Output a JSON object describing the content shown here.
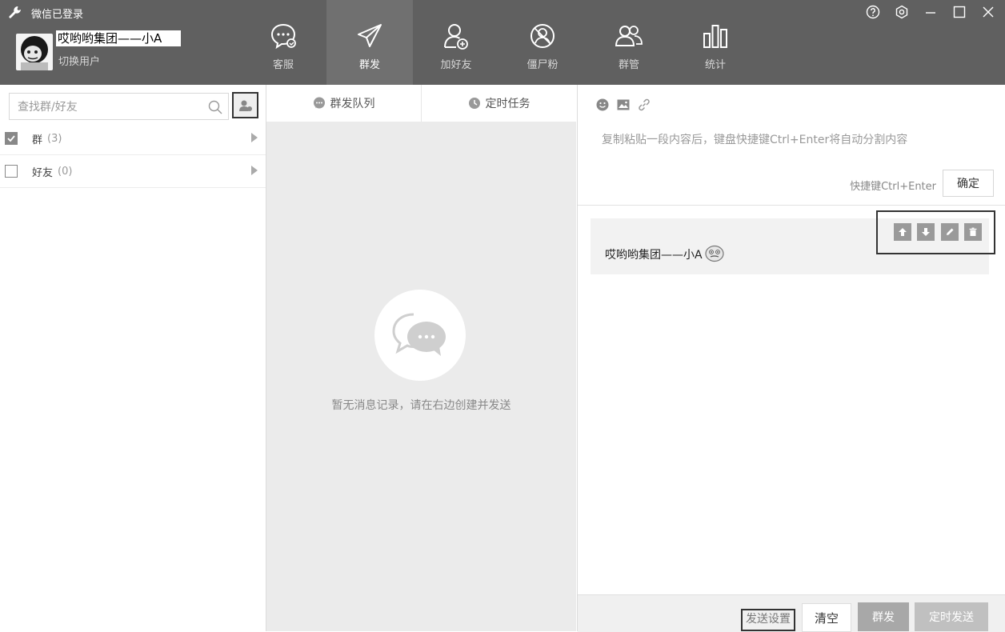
{
  "app": {
    "title": "微信已登录",
    "user_name": "哎哟哟集团——小A",
    "switch_user": "切换用户"
  },
  "nav": [
    {
      "label": "客服",
      "icon": "chat-service-icon"
    },
    {
      "label": "群发",
      "icon": "paper-plane-icon",
      "active": true
    },
    {
      "label": "加好友",
      "icon": "add-friend-icon"
    },
    {
      "label": "僵尸粉",
      "icon": "zombie-fan-icon"
    },
    {
      "label": "群管",
      "icon": "group-manage-icon"
    },
    {
      "label": "统计",
      "icon": "bar-stats-icon"
    }
  ],
  "left": {
    "search_placeholder": "查找群/好友",
    "tree": [
      {
        "name": "群",
        "count": "(3)",
        "checked": true
      },
      {
        "name": "好友",
        "count": "(0)",
        "checked": false
      }
    ]
  },
  "middle": {
    "tabs": [
      {
        "label": "群发队列",
        "icon": "chat-bubble-icon"
      },
      {
        "label": "定时任务",
        "icon": "clock-icon"
      }
    ],
    "empty_text": "暂无消息记录，请在右边创建并发送"
  },
  "right": {
    "hint": "复制粘贴一段内容后，键盘快捷键Ctrl+Enter将自动分割内容",
    "shortcut": "快捷键Ctrl+Enter",
    "confirm": "确定",
    "message": "哎哟哟集团——小A",
    "bottom": {
      "send_settings": "发送设置",
      "clear": "清空",
      "mass_send": "群发",
      "timed_send": "定时发送"
    }
  },
  "colors": {
    "topbar": "#606060",
    "nav_active": "#707070",
    "middle_bg": "#ebebeb"
  }
}
